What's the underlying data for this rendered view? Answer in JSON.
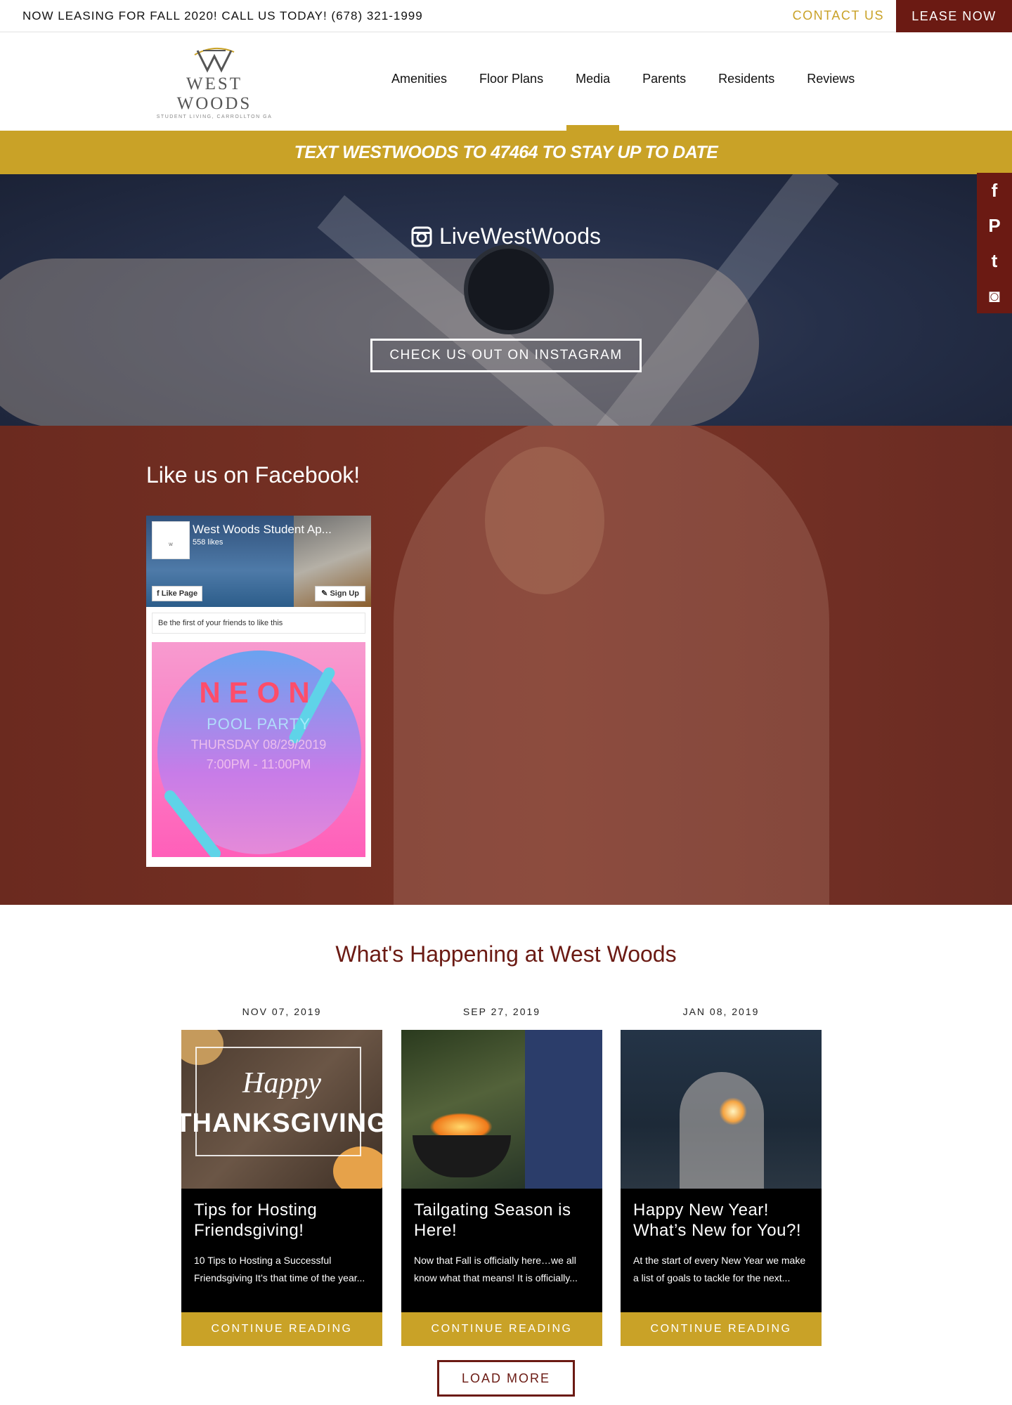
{
  "topbar": {
    "promo": "NOW LEASING FOR FALL 2020! CALL US TODAY! (678) 321-1999",
    "contact": "CONTACT US",
    "lease": "LEASE NOW"
  },
  "logo": {
    "brand": "WEST WOODS",
    "tagline": "STUDENT LIVING, CARROLLTON GA"
  },
  "nav": {
    "items": [
      {
        "label": "Amenities"
      },
      {
        "label": "Floor Plans"
      },
      {
        "label": "Media"
      },
      {
        "label": "Parents"
      },
      {
        "label": "Residents"
      },
      {
        "label": "Reviews"
      }
    ],
    "active": "Media"
  },
  "banner": {
    "text": "TEXT WESTWOODS TO 47464 TO STAY UP TO DATE"
  },
  "instagram": {
    "handle": "LiveWestWoods",
    "button": "CHECK US OUT ON INSTAGRAM"
  },
  "social": {
    "items": [
      "facebook-icon",
      "pinterest-icon",
      "twitter-icon",
      "instagram-icon"
    ],
    "glyphs": [
      "f",
      "P",
      "t",
      "◙"
    ]
  },
  "facebook": {
    "heading": "Like us on Facebook!",
    "page_name": "West Woods Student Ap...",
    "likes": "558 likes",
    "like_button": "Like Page",
    "signup_button": "Sign Up",
    "friends_text": "Be the first of your friends to like this",
    "post": {
      "line1": "NEON",
      "line2": "POOL PARTY",
      "line3": "THURSDAY 08/29/2019",
      "line4": "7:00PM - 11:00PM"
    }
  },
  "happenings": {
    "heading": "What's Happening at West Woods",
    "posts": [
      {
        "date": "NOV 07, 2019",
        "image_text_1": "Happy",
        "image_text_2": "THANKSGIVING",
        "title": "Tips for Hosting Friendsgiving!",
        "excerpt": "10 Tips to Hosting a Successful Friendsgiving   It’s that time of the year...",
        "cta": "CONTINUE READING"
      },
      {
        "date": "SEP 27, 2019",
        "title": "Tailgating Season is Here!",
        "excerpt": "Now that Fall is officially here…we all know what that means! It is officially...",
        "cta": "CONTINUE READING"
      },
      {
        "date": "JAN 08, 2019",
        "title": "Happy New Year! What’s New for You?!",
        "excerpt": "At the start of every New Year we make a list of goals to tackle for the next...",
        "cta": "CONTINUE READING"
      }
    ],
    "load_more": "LOAD MORE"
  },
  "colors": {
    "gold": "#c9a227",
    "maroon": "#6b1a13"
  }
}
